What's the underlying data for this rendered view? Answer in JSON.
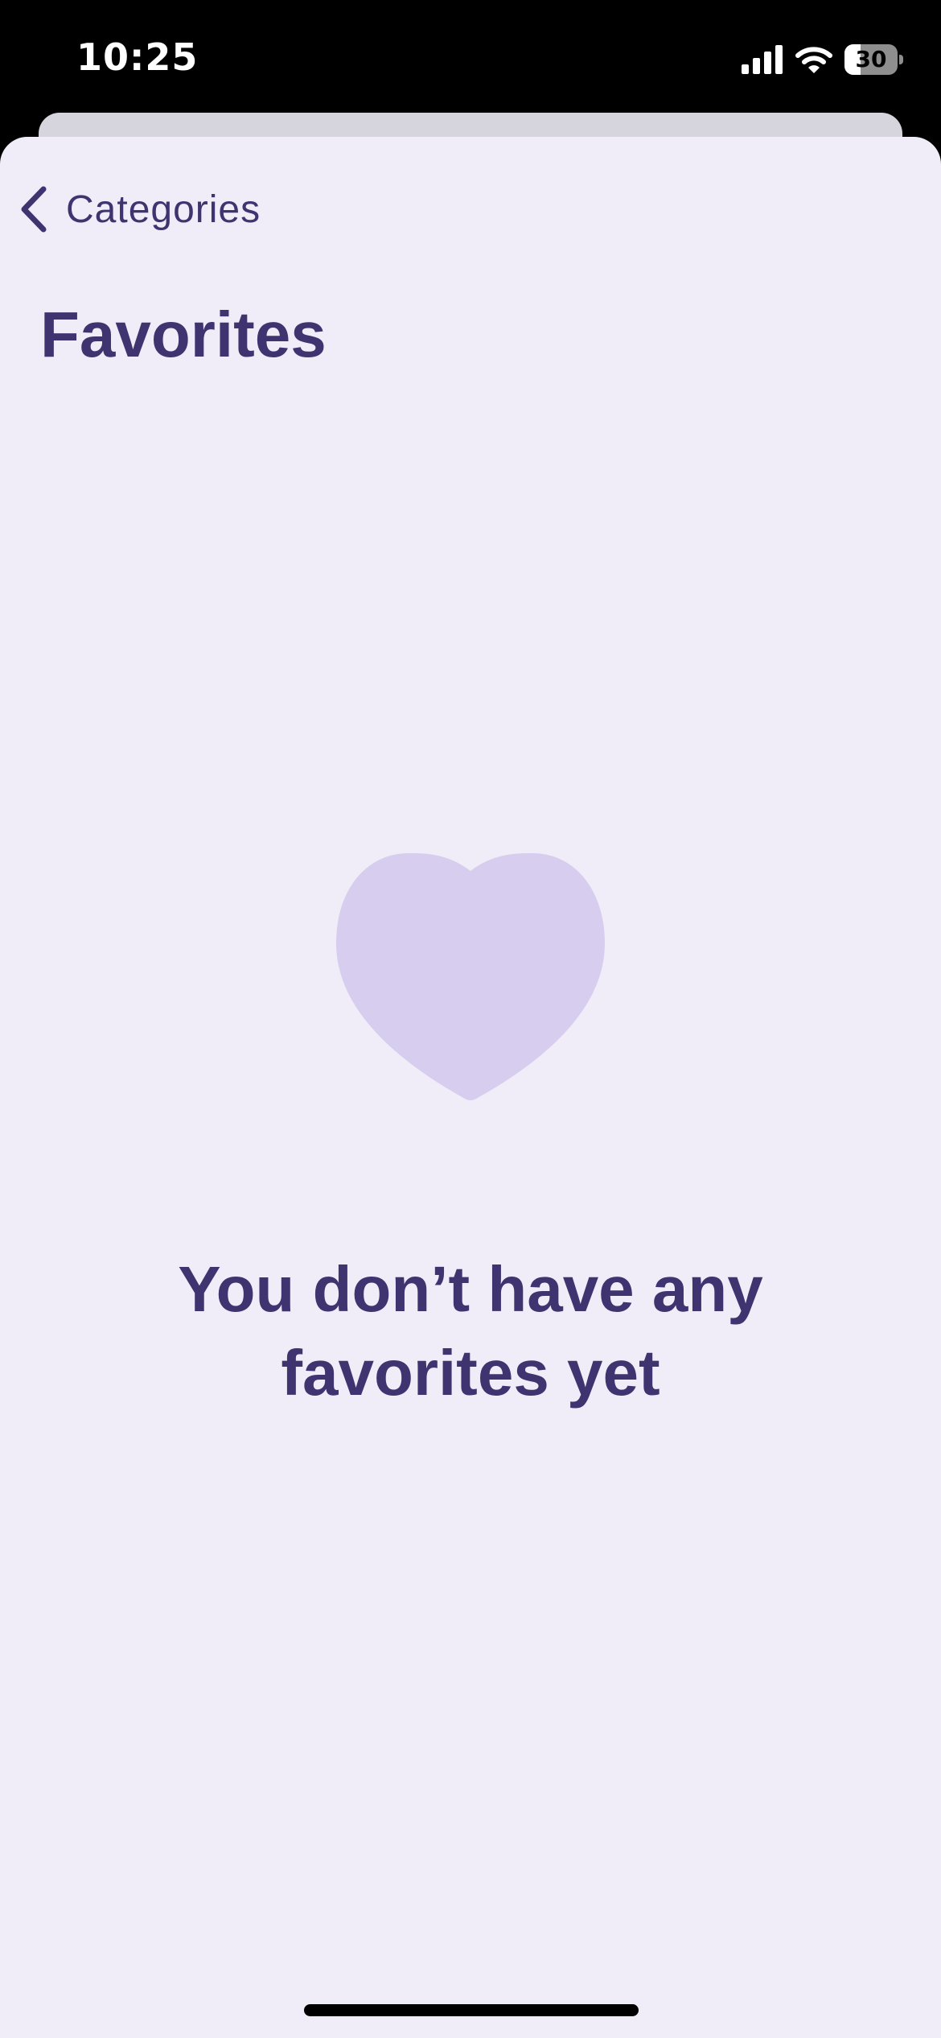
{
  "status_bar": {
    "time": "10:25",
    "battery_level": "30",
    "battery_fraction": 0.3,
    "icons": [
      "cellular-signal-icon",
      "wifi-icon",
      "battery-icon"
    ]
  },
  "nav": {
    "back_label": "Categories",
    "back_icon": "chevron-left-icon"
  },
  "page": {
    "title": "Favorites"
  },
  "empty_state": {
    "icon": "heart-icon",
    "message": "You don’t have any favorites yet"
  },
  "colors": {
    "primary_text": "#3f3470",
    "background": "#f0edf8",
    "heart": "#d7cdee",
    "status_bar": "#000000"
  }
}
